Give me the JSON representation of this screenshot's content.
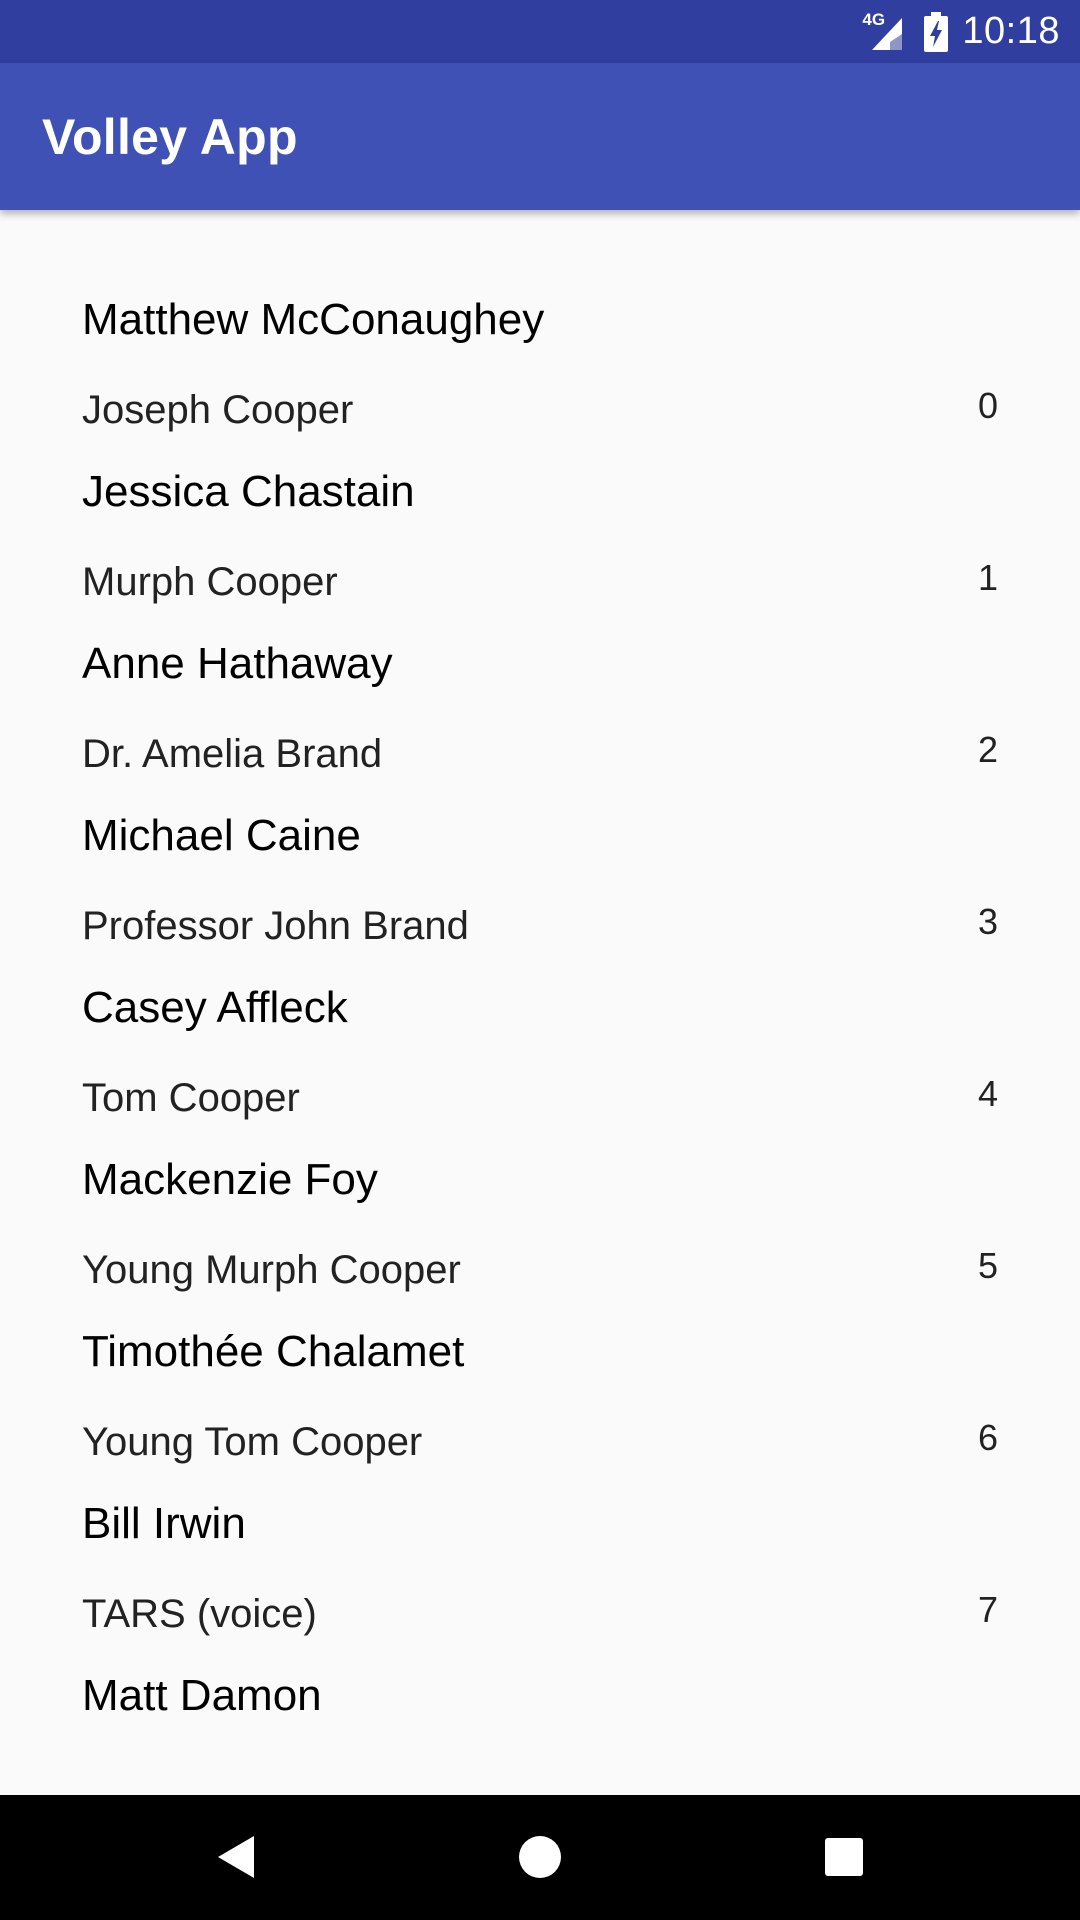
{
  "status_bar": {
    "network": "4G",
    "time": "10:18",
    "icons": [
      "signal-icon",
      "battery-charging-icon"
    ]
  },
  "app_bar": {
    "title": "Volley App"
  },
  "cast": [
    {
      "actor": "Matthew McConaughey",
      "character": "Joseph Cooper",
      "index": "0"
    },
    {
      "actor": "Jessica Chastain",
      "character": "Murph Cooper",
      "index": "1"
    },
    {
      "actor": "Anne Hathaway",
      "character": "Dr. Amelia Brand",
      "index": "2"
    },
    {
      "actor": "Michael Caine",
      "character": "Professor John Brand",
      "index": "3"
    },
    {
      "actor": "Casey Affleck",
      "character": "Tom Cooper",
      "index": "4"
    },
    {
      "actor": "Mackenzie Foy",
      "character": "Young Murph Cooper",
      "index": "5"
    },
    {
      "actor": "Timothée Chalamet",
      "character": "Young Tom Cooper",
      "index": "6"
    },
    {
      "actor": "Bill Irwin",
      "character": "TARS (voice)",
      "index": "7"
    },
    {
      "actor": "Matt Damon",
      "character": "",
      "index": ""
    }
  ],
  "nav_bar": {
    "icons": [
      "back-icon",
      "home-icon",
      "recents-icon"
    ]
  },
  "colors": {
    "status_bar": "#303f9f",
    "app_bar": "#3f51b5",
    "background": "#fafafa",
    "nav_bar": "#000000"
  }
}
